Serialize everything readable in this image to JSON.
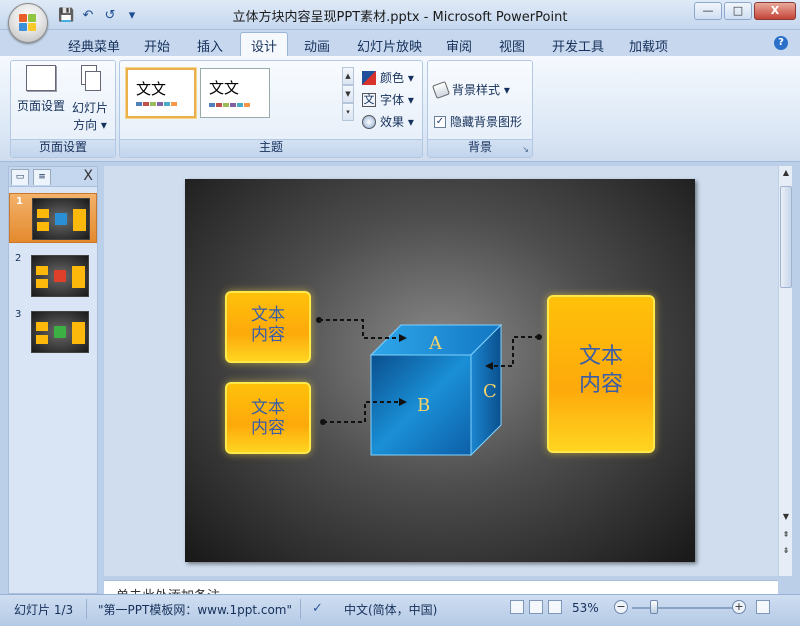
{
  "window": {
    "title": "立体方块内容呈现PPT素材.pptx - Microsoft PowerPoint",
    "controls": {
      "minimize": "—",
      "maximize": "□",
      "close": "X"
    }
  },
  "qat": {
    "save": "💾",
    "undo": "↶",
    "redo": "↺",
    "customize": "▾"
  },
  "tabs": [
    "经典菜单",
    "开始",
    "插入",
    "设计",
    "动画",
    "幻灯片放映",
    "审阅",
    "视图",
    "开发工具",
    "加载项"
  ],
  "active_tab": "设计",
  "ribbon": {
    "page_setup_group": {
      "label": "页面设置",
      "page_setup": "页面设置",
      "orientation_line1": "幻灯片",
      "orientation_line2": "方向 ▾"
    },
    "themes_group": {
      "label": "主题",
      "theme1_text": "文文",
      "theme2_text": "文文",
      "colors": "颜色 ▾",
      "fonts": "字体 ▾",
      "effects": "效果 ▾"
    },
    "background_group": {
      "label": "背景",
      "background_styles": "背景样式 ▾",
      "hide_background": "隐藏背景图形",
      "hide_background_checked": true
    }
  },
  "slides_pane": {
    "tab_close": "X",
    "thumbnails": [
      {
        "number": "1",
        "accent": "#2b8fd6",
        "selected": true
      },
      {
        "number": "2",
        "accent": "#e0402a",
        "selected": false
      },
      {
        "number": "3",
        "accent": "#3cb043",
        "selected": false
      }
    ]
  },
  "slide": {
    "box_left_top": {
      "line1": "文本",
      "line2": "内容"
    },
    "box_left_bottom": {
      "line1": "文本",
      "line2": "内容"
    },
    "box_right": {
      "line1": "文本",
      "line2": "内容"
    },
    "cube_labels": {
      "top": "A",
      "front": "B",
      "side": "C"
    }
  },
  "notes": {
    "text": "单击此处添加备注"
  },
  "status": {
    "slide_position": "幻灯片 1/3",
    "theme_name": "\"第一PPT模板网：www.1ppt.com\"",
    "language": "中文(简体，中国)",
    "zoom": "53%",
    "zoom_out": "−",
    "zoom_in": "+"
  },
  "colors": {
    "box_fill": "#fdb90b",
    "box_border": "#ffe84a",
    "cube_blue": "#1a8fd6",
    "label_text": "#3a5ea6"
  }
}
